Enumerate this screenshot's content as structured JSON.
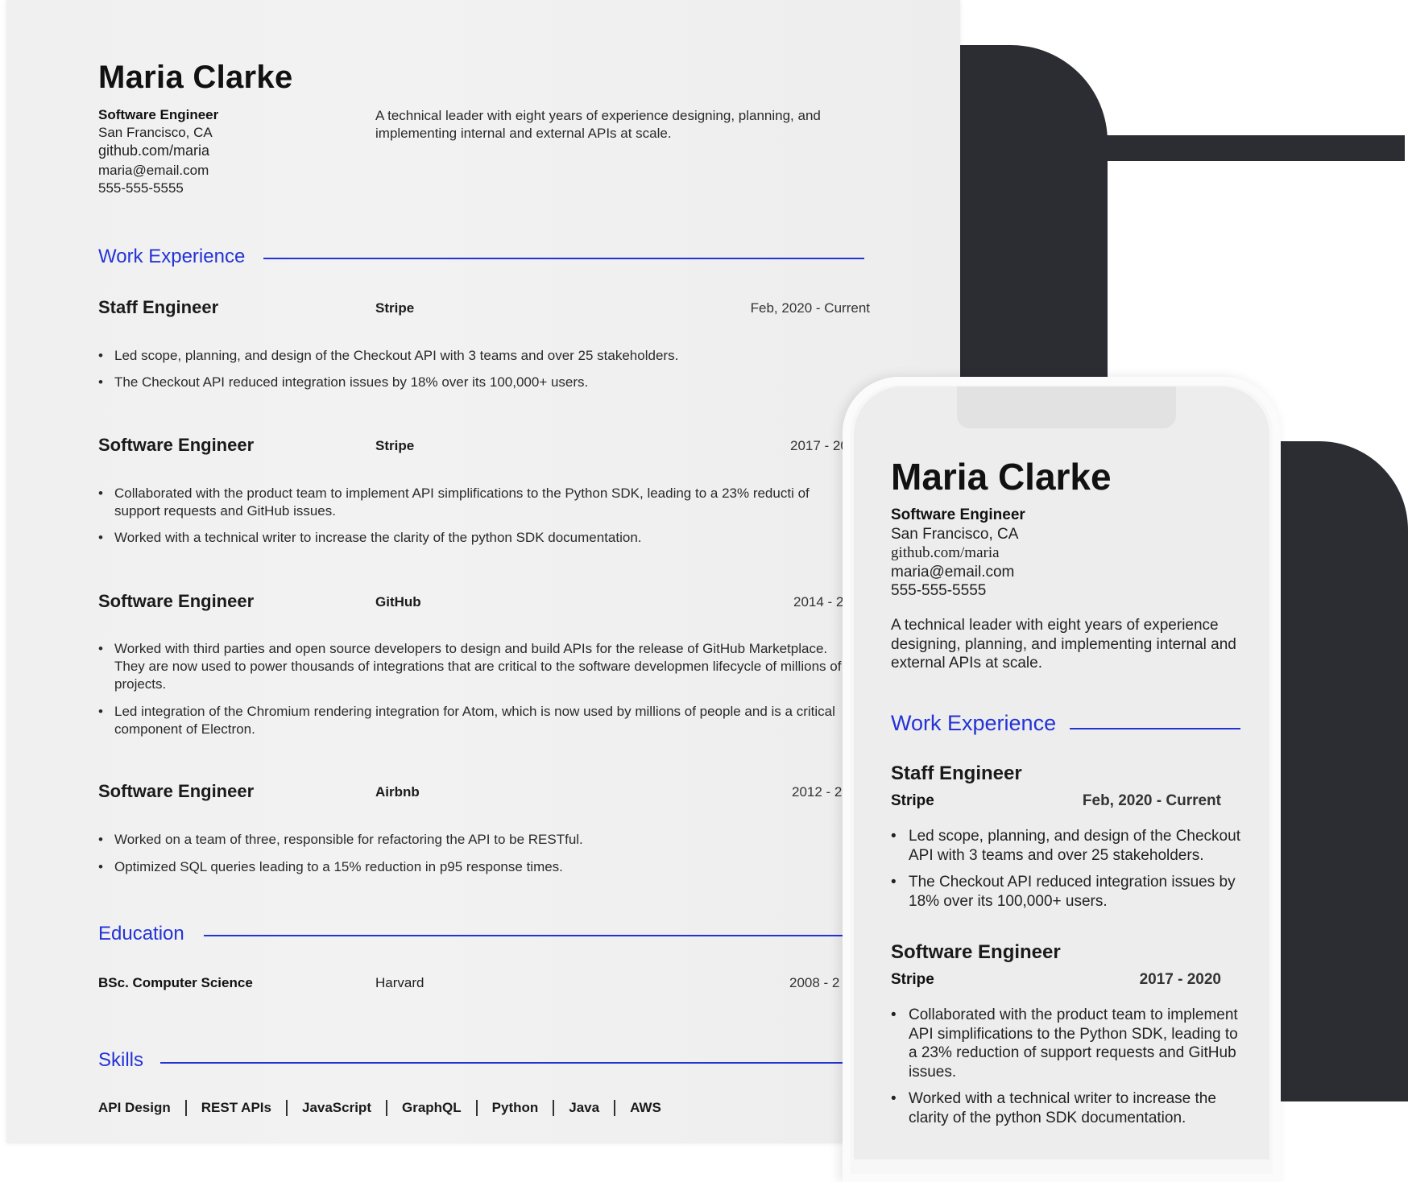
{
  "resume": {
    "name": "Maria Clarke",
    "title": "Software Engineer",
    "location": "San Francisco, CA",
    "github": "github.com/maria",
    "email": "maria@email.com",
    "phone": "555-555-5555",
    "summary": "A technical leader with eight years of experience designing, planning, and implementing internal and external APIs at scale.",
    "sections": {
      "work": "Work Experience",
      "education": "Education",
      "skills": "Skills"
    },
    "jobs": [
      {
        "title": "Staff Engineer",
        "company": "Stripe",
        "dates": "Feb, 2020 - Current",
        "bullets": [
          "Led scope, planning, and design of the Checkout API with 3 teams and over 25 stakeholders.",
          "The Checkout API reduced integration issues by 18% over its 100,000+ users."
        ]
      },
      {
        "title": "Software Engineer",
        "company": "Stripe",
        "dates": "2017 - 20",
        "bullets": [
          "Collaborated with the product team to implement API simplifications to the Python SDK, leading to a 23% reducti of support requests and GitHub issues.",
          "Worked with a technical writer to increase the clarity of the python SDK documentation."
        ]
      },
      {
        "title": "Software Engineer",
        "company": "GitHub",
        "dates": "2014 - 2",
        "bullets": [
          "Worked with third parties and open source developers to design and build APIs for the release of GitHub Marketplace. They are now used to power thousands of integrations that are critical to the software developmen lifecycle of millions of projects.",
          "Led integration of the Chromium rendering integration for Atom, which is now used by millions of people and is a critical component of Electron."
        ]
      },
      {
        "title": "Software Engineer",
        "company": "Airbnb",
        "dates": "2012 - 2",
        "bullets": [
          "Worked on a team of three, responsible for refactoring the API to be RESTful.",
          "Optimized SQL queries leading to a 15% reduction in p95 response times."
        ]
      }
    ],
    "education": {
      "degree": "BSc. Computer Science",
      "school": "Harvard",
      "dates": "2008 - 2"
    },
    "skills": [
      "API Design",
      "REST APIs",
      "JavaScript",
      "GraphQL",
      "Python",
      "Java",
      "AWS"
    ]
  },
  "phone_view": {
    "name": "Maria Clarke",
    "title": "Software Engineer",
    "location": "San Francisco, CA",
    "github": "github.com/maria",
    "email": "maria@email.com",
    "phone": "555-555-5555",
    "summary": "A technical leader with eight years of experience designing, planning, and implementing internal and external APIs at scale.",
    "work_section": "Work Experience",
    "jobs": [
      {
        "title": "Staff Engineer",
        "company": "Stripe",
        "dates": "Feb, 2020 - Current",
        "bullets": [
          "Led scope, planning, and design of the Checkout API with 3 teams and over 25 stakeholders.",
          "The Checkout API reduced integration issues by 18% over its 100,000+ users."
        ]
      },
      {
        "title": "Software Engineer",
        "company": "Stripe",
        "dates": "2017 - 2020",
        "bullets": [
          "Collaborated with the product team to implement API simplifications to the Python SDK, leading to a 23% reduction of support requests and GitHub issues.",
          "Worked with a technical writer to increase the clarity of the python SDK documentation."
        ]
      }
    ]
  },
  "colors": {
    "accent": "#2433d6",
    "backdrop_dark": "#2c2d33",
    "sheet": "#f0f0f0"
  }
}
